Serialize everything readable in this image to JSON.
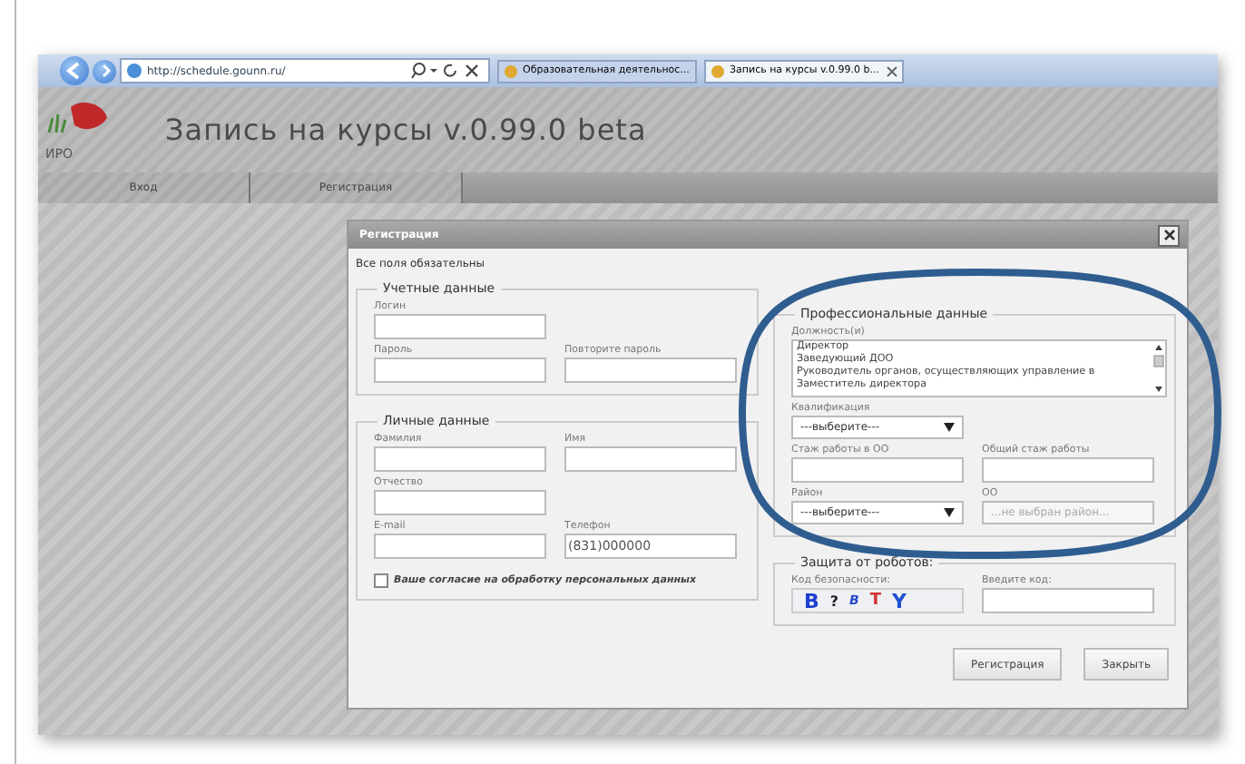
{
  "browser": {
    "address": "http://schedule.gounn.ru/",
    "tabs": [
      {
        "label": "Образовательная деятельнос...",
        "selected": false
      },
      {
        "label": "Запись на курсы v.0.99.0 b...",
        "selected": true
      }
    ]
  },
  "site": {
    "logo_text": "ИРО",
    "title": "Запись на курсы v.0.99.0 beta",
    "nav": [
      {
        "label": "Вход"
      },
      {
        "label": "Регистрация"
      }
    ]
  },
  "dialog": {
    "title": "Регистрация",
    "note": "Все поля обязательны",
    "columns": [
      [
        {
          "legend": "Учетные данные",
          "rows": [
            [
              {
                "kind": "text",
                "label": "Логин"
              }
            ],
            [
              {
                "kind": "text",
                "label": "Пароль"
              },
              {
                "kind": "text",
                "label": "Повторите пароль"
              }
            ]
          ]
        },
        {
          "legend": "Личные данные",
          "rows": [
            [
              {
                "kind": "text",
                "label": "Фамилия"
              },
              {
                "kind": "text",
                "label": "Имя"
              }
            ],
            [
              {
                "kind": "text",
                "label": "Отчество"
              }
            ],
            [
              {
                "kind": "text",
                "label": "E-mail"
              },
              {
                "kind": "text",
                "label": "Телефон",
                "value": "(831)000000"
              }
            ],
            [
              {
                "kind": "checkbox",
                "label": "Ваше согласие на обработку персональных данных",
                "checked": false
              }
            ]
          ]
        }
      ],
      [
        {
          "legend": "Профессиональные данные",
          "rows": [
            [
              {
                "kind": "listbox",
                "label": "Должность(и)",
                "options": [
                  {
                    "label": "Директор",
                    "selected": false
                  },
                  {
                    "label": "Заведующий ДОО",
                    "selected": false
                  },
                  {
                    "label": "Руководитель органов, осуществляющих управление в",
                    "selected": false
                  },
                  {
                    "label": "Заместитель директора",
                    "selected": false
                  }
                ]
              }
            ],
            [
              {
                "kind": "select",
                "label": "Квалификация",
                "value": "---выберите---",
                "disabled": false
              }
            ],
            [
              {
                "kind": "text",
                "label": "Стаж работы в ОО"
              },
              {
                "kind": "text",
                "label": "Общий стаж работы"
              }
            ],
            [
              {
                "kind": "select",
                "label": "Район",
                "value": "---выберите---",
                "disabled": false
              },
              {
                "kind": "select",
                "label": "ОО",
                "placeholder": "...не выбран район...",
                "disabled": true
              }
            ]
          ]
        },
        {
          "legend": "Защита от роботов:",
          "rows": [
            [
              {
                "kind": "captcha",
                "label": "Код безопасности:",
                "letters": [
                  {
                    "char": "B",
                    "color": "#1f3fd0"
                  },
                  {
                    "char": "?",
                    "color": "#222222"
                  },
                  {
                    "char": "B",
                    "color": "#2848c8"
                  },
                  {
                    "char": "T",
                    "color": "#d03030"
                  },
                  {
                    "char": "Y",
                    "color": "#2050d0"
                  }
                ]
              },
              {
                "kind": "text",
                "label": "Введите код:"
              }
            ]
          ]
        }
      ]
    ],
    "buttons": [
      "Регистрация",
      "Закрыть"
    ]
  }
}
